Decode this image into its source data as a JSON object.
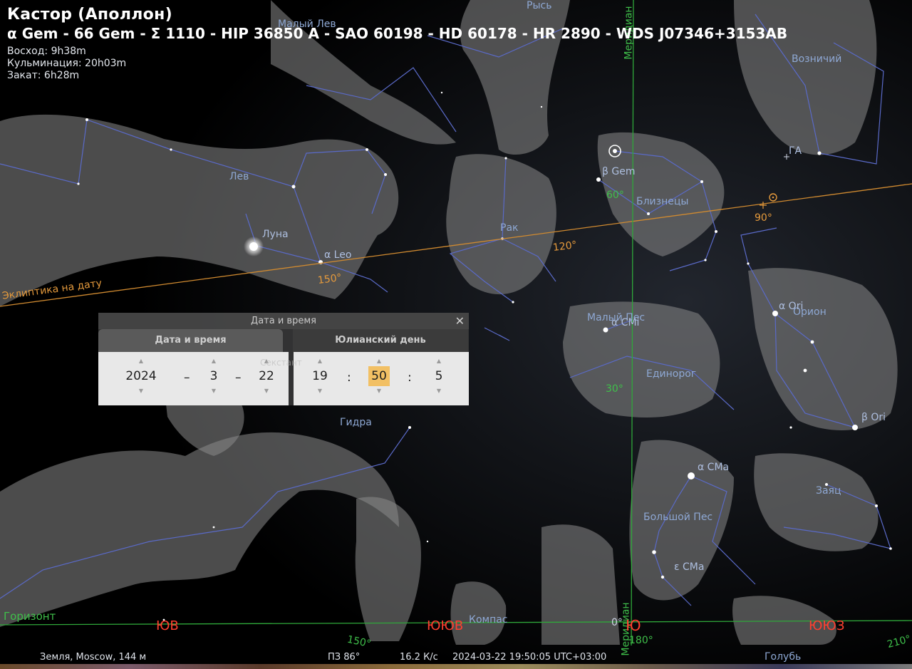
{
  "object": {
    "title": "Кастор (Аполлон)",
    "designations": "α Gem - 66 Gem - Σ 1110 - HIP 36850 A - SAO 60198 - HD 60178 - HR 2890 - WDS J07346+3153AB",
    "rise": "Восход: 9h38m",
    "transit": "Кульминация: 20h03m",
    "set": "Закат: 6h28m"
  },
  "constellations": [
    "Малый Лев",
    "Рысь",
    "Возничий",
    "Лев",
    "Рак",
    "Близнецы",
    "Малый Пес",
    "Единорог",
    "Орион",
    "Гидра",
    "Большой Пес",
    "Заяц",
    "Компас",
    "Голубь",
    "Секстант"
  ],
  "stars": [
    "α Leo",
    "β Gem",
    "α CMi",
    "α Ori",
    "β Ori",
    "α CMa",
    "ε CMa"
  ],
  "bodies": {
    "moon": "Луна",
    "galactic_anticenter": "ГА"
  },
  "ecliptic": {
    "label": "Эклиптика на дату",
    "ticks": [
      "150°",
      "120°",
      "90°"
    ]
  },
  "meridian": {
    "label": "Меридиан",
    "ticks": [
      "60°",
      "30°"
    ]
  },
  "horizon": {
    "label": "Горизонт",
    "ticks": [
      "150°",
      "180°",
      "210°"
    ]
  },
  "cardinals": [
    "ЮВ",
    "ЮЮВ",
    "Ю",
    "ЮЮЗ"
  ],
  "compass_zero": "0°",
  "dialog": {
    "title": "Дата и время",
    "close": "✕",
    "tab_datetime": "Дата и время",
    "tab_julian": "Юлианский день",
    "year": "2024",
    "month": "3",
    "day": "22",
    "hour": "19",
    "minute": "50",
    "second": "5",
    "date_sep": "–",
    "time_sep": ":"
  },
  "status": {
    "location": "Земля, Moscow, 144 м",
    "fov": "ПЗ 86°",
    "fps": "16.2 К/с",
    "datetime": "2024-03-22 19:50:05 UTC+03:00"
  },
  "colors": {
    "ecliptic": "#d08a30",
    "meridian": "#2fa83a",
    "horizon": "#2fa83a",
    "cardinal": "#ff4030",
    "constellation_lines": "#5a6ac8"
  }
}
